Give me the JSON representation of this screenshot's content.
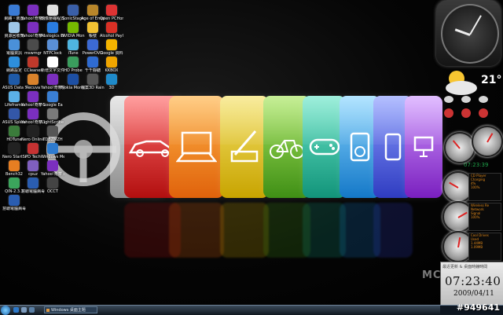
{
  "desktop_icons": [
    {
      "label": "網路・裝置",
      "color": "#3a7bd5"
    },
    {
      "label": "Yahoo!奇摩電子信箱",
      "color": "#7b2fbf"
    },
    {
      "label": "影像壓縮程式",
      "color": "#e0e0e0"
    },
    {
      "label": "SonicStage",
      "color": "#3a5fa8"
    },
    {
      "label": "Age of Empires III",
      "color": "#b8862a"
    },
    {
      "label": "Open PCHome",
      "color": "#d33"
    },
    {
      "label": "資源回收筒",
      "color": "#9ec7e8"
    },
    {
      "label": "Yahoo!奇摩 Messenger",
      "color": "#7b2fbf"
    },
    {
      "label": "Auslogics Disk Defrag",
      "color": "#2a7de1"
    },
    {
      "label": "NVIDIA Monitor",
      "color": "#76b900"
    },
    {
      "label": "帳號",
      "color": "#f1c232"
    },
    {
      "label": "Alcohol Payload",
      "color": "#d93025"
    },
    {
      "label": "電腦資訊",
      "color": "#4a90d9"
    },
    {
      "label": "mswmgr",
      "color": "#4b4b4b"
    },
    {
      "label": "NTPClock",
      "color": "#5a8fd6"
    },
    {
      "label": "iTune",
      "color": "#4fb5e0"
    },
    {
      "label": "PowerDVD",
      "color": "#3c6ad3"
    },
    {
      "label": "Google 資料",
      "color": "#f4b400"
    },
    {
      "label": "網路設定",
      "color": "#2d8fdc"
    },
    {
      "label": "CCleaner",
      "color": "#c0392b"
    },
    {
      "label": "新增文字文件",
      "color": "#ffffff"
    },
    {
      "label": "HD Probe",
      "color": "#3a9d5d"
    },
    {
      "label": "千千靜聽",
      "color": "#2f6bd1"
    },
    {
      "label": "KKBOX",
      "color": "#f0a500"
    },
    {
      "label": "ASUS Data Security",
      "color": "#1e5aa8"
    },
    {
      "label": "Recuva",
      "color": "#d9822b"
    },
    {
      "label": "Yahoo!奇摩拍賣",
      "color": "#7b2fbf"
    },
    {
      "label": "Nokia Monitor Tool",
      "color": "#1d4fa3"
    },
    {
      "label": "檔案3D Rainmeter",
      "color": "#555"
    },
    {
      "label": "3D",
      "color": "#1f8ac9"
    },
    {
      "label": "Lifeframe",
      "color": "#5bb0e6"
    },
    {
      "label": "Yahoo!奇摩 Widget E",
      "color": "#7b2fbf"
    },
    {
      "label": "Google Ea",
      "color": "#3a7fd4"
    },
    {
      "label": "ASUS Splendid",
      "color": "#3357a8"
    },
    {
      "label": "Yahoo!奇摩 Widget",
      "color": "#7b2fbf"
    },
    {
      "label": "LightScribe",
      "color": "#7a7a7a"
    },
    {
      "label": "HDTune",
      "color": "#3b7c3b"
    },
    {
      "label": "Nero Online Upgrade",
      "color": "#222"
    },
    {
      "label": "TDBZMZH",
      "color": "#555"
    },
    {
      "label": "Nero StartSm",
      "color": "#222"
    },
    {
      "label": "PD Tech",
      "color": "#c53232"
    },
    {
      "label": "Windows Media",
      "color": "#2e7bcf"
    },
    {
      "label": "Bench32",
      "color": "#e67e22"
    },
    {
      "label": "cpuz",
      "color": "#7f5fbf"
    },
    {
      "label": "Yahoo!奇摩 即時通 Vi",
      "color": "#7b2fbf"
    },
    {
      "label": "QIN-2.3.3",
      "color": "#3ba55c"
    },
    {
      "label": "慧聰電腦病毒",
      "color": "#2a5db0"
    },
    {
      "label": "OCCT",
      "color": "#444"
    },
    {
      "label": "慧聰電腦病毒 尋者 2",
      "color": "#2a5db0"
    }
  ],
  "wallpaper": {
    "watermark": "MC",
    "status_text": "07:23:39"
  },
  "gadgets": {
    "weather": {
      "temperature": "21°"
    },
    "meter_panels": [
      {
        "line1": "CD Player",
        "line2": "Charging",
        "line3": "4%",
        "line4": "100%"
      },
      {
        "line1": "Wireless Re",
        "line2": "Network",
        "line3": "Signal",
        "line4": "100%"
      },
      {
        "line1": "Cool Drives",
        "line2": "Used",
        "line3": "1.44MB",
        "line4": "1.09MB"
      }
    ],
    "digital_clock": {
      "header": "最近更新 & 桌面時鐘時間",
      "time": "07:23:40",
      "date": "2009/04/11"
    }
  },
  "taskbar": {
    "task_label": "Windows 桌面主題"
  },
  "tag": "#949641"
}
